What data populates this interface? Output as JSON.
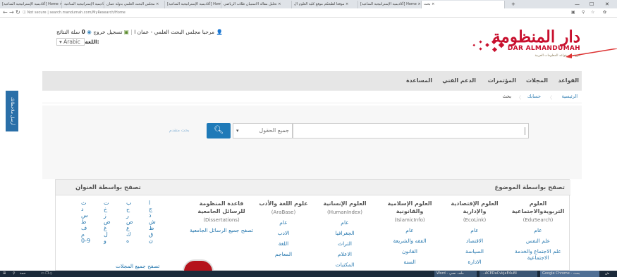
{
  "browser": {
    "tabs": [
      "[أكاديمية الإستراتيجية المناعية] Home ×",
      "أكاديمية الإستراتيجية المناعية ×",
      "مجلس البحث العلمي بدولة عمان ×",
      "[أكاديمية الإستراتيجية المناعية] Home ×",
      "تحليل مقالة الاستبيان طلاب الرياضي ×",
      "موقعا لطبعكم موقع كلية العلوم ال ×",
      "[أكاديمية الإستراتيجية المناعية] Home ×",
      "بحث ×"
    ],
    "new_tab": "+",
    "window_controls": [
      "—",
      "☐",
      "✕"
    ],
    "url_prefix": "Not secure",
    "url": "search.mandumah.com/MyResearch/Home"
  },
  "header": {
    "logo_ar": "دار المنظومة",
    "logo_en": "DAR ALMANDUMAH",
    "logo_tagline": "الرواد في قواعد المعلومات العربية",
    "welcome": "مرحبا مجلس البحث العلمي - عمان ا",
    "logout": "تسجيل خروج",
    "cart_count": "0",
    "cart_label": "سلة النتائج",
    "language_label": "اللغة:",
    "language_value": "Arabic"
  },
  "nav": {
    "items": [
      "القواعد",
      "المجلات",
      "المؤتمرات",
      "الدعم الفني",
      "المساعدة"
    ]
  },
  "breadcrumb": [
    "الرئيسية",
    "حسابك",
    "بحث"
  ],
  "feedback": "أرسل ملاحظاتك",
  "search": {
    "field_placeholder": "جميع الحقول",
    "button_icon": "search-icon",
    "advanced": "بحث متقدم"
  },
  "panel": {
    "subject_title": "تصفح بواسطة الموضوع",
    "title_browse": "تصفح بواسطة العنوان",
    "columns": [
      {
        "title": "العلوم التربويةوالاجتماعية",
        "sub": "(EduSearch)",
        "links": [
          "عام",
          "علم النفس",
          "علم الاجتماع والخدمة الاجتماعية"
        ]
      },
      {
        "title": "العلوم الإقتصادية والإدارية",
        "sub": "(EcoLink)",
        "links": [
          "عام",
          "الاقتصاد",
          "السياسة",
          "الادارة"
        ]
      },
      {
        "title": "العلوم الإسلامية والقانونية",
        "sub": "(IslamicInfo)",
        "links": [
          "عام",
          "الفقه والشريعة",
          "القانون",
          "السنة"
        ]
      },
      {
        "title": "العلوم الإنسانية",
        "sub": "(HumanIndex)",
        "links": [
          "عام",
          "الجغرافيا",
          "التراث",
          "الاعلام",
          "المكتبات"
        ]
      },
      {
        "title": "علوم اللغة والأدب",
        "sub": "(AraBase)",
        "links": [
          "عام",
          "الادب",
          "اللغة",
          "المعاجم"
        ]
      },
      {
        "title": "قاعدة المنظومة للرسائل الجامعية",
        "sub": "(Dissertations)",
        "links": [
          "تصفح جميع الرسائل الجامعية"
        ]
      }
    ],
    "letters": [
      [
        "ا",
        "ب",
        "ت",
        "ث"
      ],
      [
        "ج",
        "ح",
        "خ",
        "د"
      ],
      [
        "ذ",
        "ر",
        "ز",
        "س"
      ],
      [
        "ش",
        "ص",
        "ض",
        "ط"
      ],
      [
        "ظ",
        "ع",
        "غ",
        "ف"
      ],
      [
        "ق",
        "ك",
        "ل",
        "م"
      ],
      [
        "ن",
        "ه",
        "و",
        "0-9"
      ]
    ],
    "letters_footer": "تصفح جميع المجلات"
  },
  "taskbar": {
    "search": "حمد",
    "items": [
      "Word - ملف نصي",
      "...ACEDaCvkjaE4uBl",
      "Google Chrome - بحث"
    ],
    "time": "ش"
  }
}
